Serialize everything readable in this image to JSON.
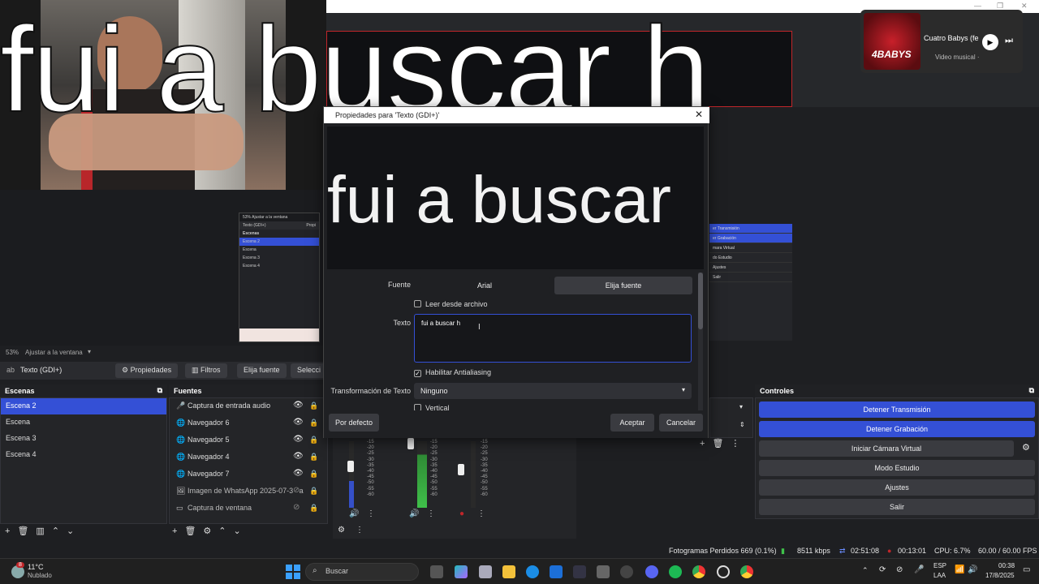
{
  "big_overlay_text": "fui a buscar h",
  "titlebar": {
    "controls": [
      "—",
      "❐",
      "✕"
    ]
  },
  "youtube_popup": {
    "title": "Cuatro Babys (fe",
    "subtitle": "Video musical ·",
    "thumb_text": "4BABYS",
    "play": "▶",
    "next": "⏭"
  },
  "zoom": {
    "percent": "53%",
    "label": "Ajustar a la ventana"
  },
  "source_toolbar": {
    "selected_source": "Texto (GDI+)",
    "properties": "Propiedades",
    "filters": "Filtros",
    "choose_font": "Elija fuente",
    "select": "Selecci"
  },
  "scenes": {
    "title": "Escenas",
    "items": [
      {
        "label": "Escena 2",
        "selected": true
      },
      {
        "label": "Escena",
        "selected": false
      },
      {
        "label": "Escena 3",
        "selected": false
      },
      {
        "label": "Escena 4",
        "selected": false
      }
    ]
  },
  "sources": {
    "title": "Fuentes",
    "items": [
      {
        "label": "Captura de entrada audio",
        "icon": "microphone-icon",
        "glyph": "🎤",
        "visible": true
      },
      {
        "label": "Navegador 6",
        "icon": "globe-icon",
        "glyph": "🌐",
        "visible": true
      },
      {
        "label": "Navegador 5",
        "icon": "globe-icon",
        "glyph": "🌐",
        "visible": true
      },
      {
        "label": "Navegador 4",
        "icon": "globe-icon",
        "glyph": "🌐",
        "visible": true
      },
      {
        "label": "Navegador 7",
        "icon": "globe-icon",
        "glyph": "🌐",
        "visible": true
      },
      {
        "label": "Imagen de WhatsApp 2025-07-30 a",
        "icon": "image-icon",
        "glyph": "🖼",
        "visible": false
      },
      {
        "label": "Captura de ventana",
        "icon": "window-icon",
        "glyph": "▭",
        "visible": false
      }
    ]
  },
  "controls": {
    "title": "Controles",
    "buttons": [
      {
        "label": "Detener Transmisión",
        "active": true
      },
      {
        "label": "Detener Grabación",
        "active": true
      },
      {
        "label": "Iniciar Cámara Virtual",
        "active": false
      },
      {
        "label": "Modo Estudio",
        "active": false
      },
      {
        "label": "Ajustes",
        "active": false
      },
      {
        "label": "Salir",
        "active": false
      }
    ]
  },
  "mixer": {
    "scale": [
      "-15",
      "-20",
      "-25",
      "-30",
      "-35",
      "-40",
      "-45",
      "-50",
      "-55",
      "-60"
    ]
  },
  "nested_preview": {
    "zoom": "53%",
    "zoom_label": "Ajustar a la ventana",
    "source": "Texto (GDI+)",
    "props": "Propi",
    "scenes_title": "Escenas",
    "scenes": [
      "Escena 2",
      "Escena",
      "Escena 3",
      "Escena 4"
    ]
  },
  "side_mini": {
    "items": [
      "er Transmisión",
      "er Grabación",
      "mara Virtual",
      "do Estudio",
      "Ajustes",
      "Salir"
    ]
  },
  "dialog": {
    "title": "Propiedades para 'Texto (GDI+)'",
    "preview_text": "fui a buscar",
    "font_label": "Fuente",
    "font_value": "Arial",
    "font_button": "Elija fuente",
    "read_file": "Leer desde archivo",
    "text_label": "Texto",
    "text_value": "fui a buscar h",
    "antialias": "Habilitar Antialiasing",
    "transform_label": "Transformación de Texto",
    "transform_value": "Ninguno",
    "vertical": "Vertical",
    "defaults_button": "Por defecto",
    "ok_button": "Aceptar",
    "cancel_button": "Cancelar"
  },
  "status": {
    "dropped_frames": "Fotogramas Perdidos 669 (0.1%)",
    "bitrate": "8511 kbps",
    "stream_time": "02:51:08",
    "rec_time": "00:13:01",
    "cpu": "CPU: 6.7%",
    "fps": "60.00 / 60.00 FPS"
  },
  "taskbar": {
    "weather_temp": "11°C",
    "weather_desc": "Nublado",
    "weather_badge": "8",
    "search": "Buscar",
    "lang_top": "ESP",
    "lang_bottom": "LAA",
    "time": "00:38",
    "date": "17/8/2025"
  },
  "colors": {
    "accent": "#3450d6",
    "record": "#c0262a",
    "meter_green": "#3fc04a"
  }
}
